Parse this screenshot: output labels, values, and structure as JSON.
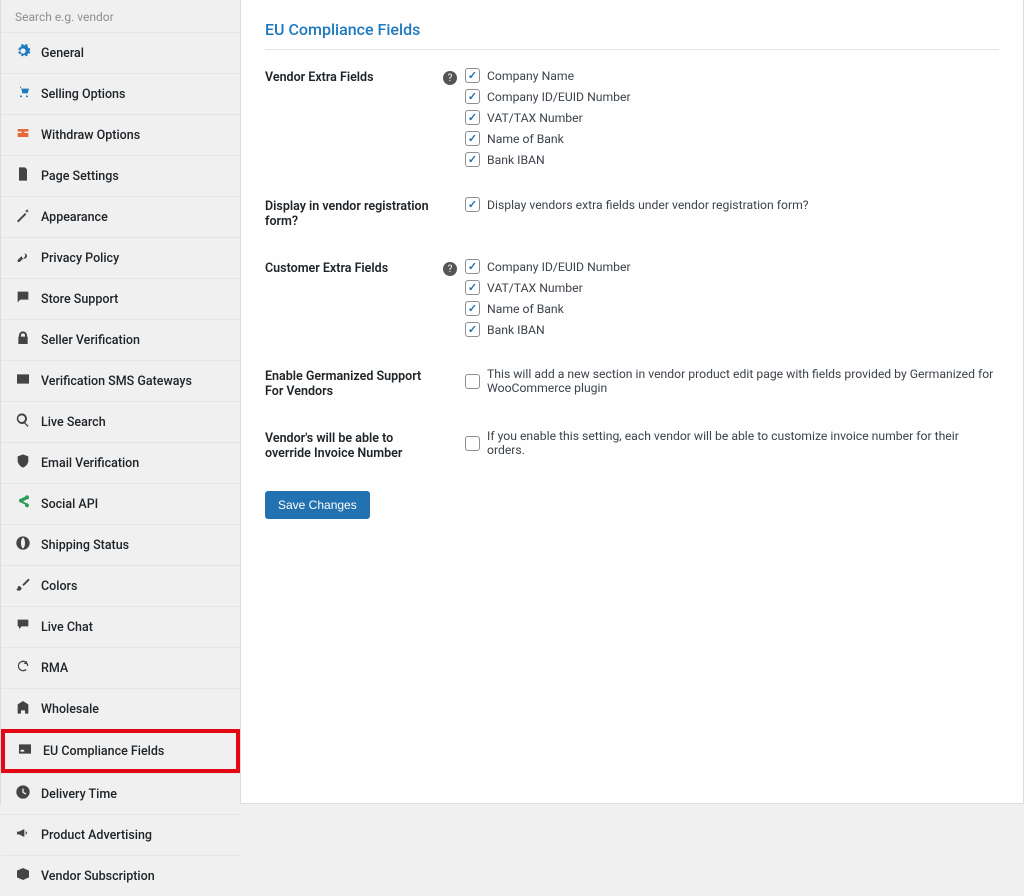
{
  "sidebar": {
    "search_placeholder": "Search e.g. vendor",
    "items": [
      {
        "id": "general",
        "label": "General",
        "icon": "gear",
        "color": "blue"
      },
      {
        "id": "selling-options",
        "label": "Selling Options",
        "icon": "cart",
        "color": "blue"
      },
      {
        "id": "withdraw-options",
        "label": "Withdraw Options",
        "icon": "withdraw",
        "color": "orange"
      },
      {
        "id": "page-settings",
        "label": "Page Settings",
        "icon": "page",
        "color": "dark"
      },
      {
        "id": "appearance",
        "label": "Appearance",
        "icon": "wand",
        "color": "dark"
      },
      {
        "id": "privacy-policy",
        "label": "Privacy Policy",
        "icon": "key",
        "color": "dark"
      },
      {
        "id": "store-support",
        "label": "Store Support",
        "icon": "chat",
        "color": "dark"
      },
      {
        "id": "seller-verification",
        "label": "Seller Verification",
        "icon": "lock",
        "color": "dark"
      },
      {
        "id": "verification-sms",
        "label": "Verification SMS Gateways",
        "icon": "mail",
        "color": "dark"
      },
      {
        "id": "live-search",
        "label": "Live Search",
        "icon": "search",
        "color": "dark"
      },
      {
        "id": "email-verification",
        "label": "Email Verification",
        "icon": "shield",
        "color": "dark"
      },
      {
        "id": "social-api",
        "label": "Social API",
        "icon": "share",
        "color": "green"
      },
      {
        "id": "shipping-status",
        "label": "Shipping Status",
        "icon": "globe",
        "color": "dark"
      },
      {
        "id": "colors",
        "label": "Colors",
        "icon": "brush",
        "color": "dark"
      },
      {
        "id": "live-chat",
        "label": "Live Chat",
        "icon": "chat2",
        "color": "dark"
      },
      {
        "id": "rma",
        "label": "RMA",
        "icon": "refresh",
        "color": "dark"
      },
      {
        "id": "wholesale",
        "label": "Wholesale",
        "icon": "building",
        "color": "dark"
      },
      {
        "id": "eu-compliance",
        "label": "EU Compliance Fields",
        "icon": "idcard",
        "color": "dark",
        "active": true
      },
      {
        "id": "delivery-time",
        "label": "Delivery Time",
        "icon": "clock",
        "color": "dark"
      },
      {
        "id": "product-advertising",
        "label": "Product Advertising",
        "icon": "megaphone",
        "color": "dark"
      },
      {
        "id": "vendor-subscription",
        "label": "Vendor Subscription",
        "icon": "box",
        "color": "dark"
      }
    ]
  },
  "main": {
    "title": "EU Compliance Fields",
    "sections": {
      "vendor_fields": {
        "label": "Vendor Extra Fields",
        "help": true,
        "options": [
          {
            "label": "Company Name",
            "checked": true
          },
          {
            "label": "Company ID/EUID Number",
            "checked": true
          },
          {
            "label": "VAT/TAX Number",
            "checked": true
          },
          {
            "label": "Name of Bank",
            "checked": true
          },
          {
            "label": "Bank IBAN",
            "checked": true
          }
        ]
      },
      "display_registration": {
        "label": "Display in vendor registration form?",
        "help": false,
        "options": [
          {
            "label": "Display vendors extra fields under vendor registration form?",
            "checked": true
          }
        ]
      },
      "customer_fields": {
        "label": "Customer Extra Fields",
        "help": true,
        "options": [
          {
            "label": "Company ID/EUID Number",
            "checked": true
          },
          {
            "label": "VAT/TAX Number",
            "checked": true
          },
          {
            "label": "Name of Bank",
            "checked": true
          },
          {
            "label": "Bank IBAN",
            "checked": true
          }
        ]
      },
      "germanized": {
        "label": "Enable Germanized Support For Vendors",
        "help": false,
        "options": [
          {
            "label": "This will add a new section in vendor product edit page with fields provided by Germanized for WooCommerce plugin",
            "checked": false
          }
        ]
      },
      "override_invoice": {
        "label": "Vendor's will be able to override Invoice Number",
        "help": false,
        "options": [
          {
            "label": "If you enable this setting, each vendor will be able to customize invoice number for their orders.",
            "checked": false
          }
        ]
      }
    },
    "save_button": "Save Changes"
  }
}
